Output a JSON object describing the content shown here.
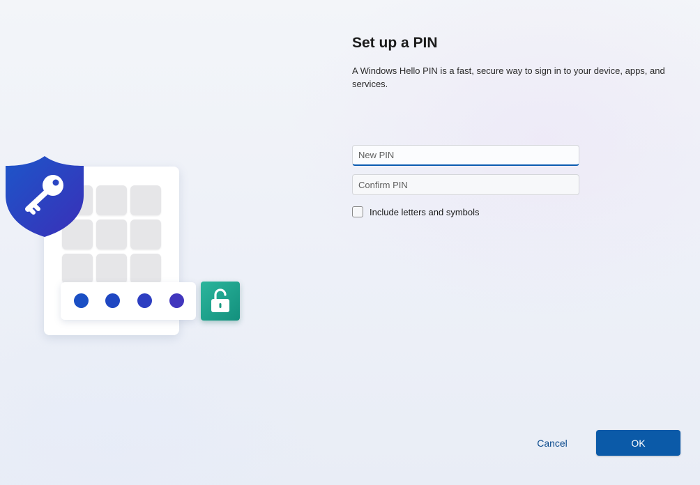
{
  "page": {
    "title": "Set up a PIN",
    "description": "A Windows Hello PIN is a fast, secure way to sign in to your device, apps, and services."
  },
  "form": {
    "new_pin": {
      "placeholder": "New PIN",
      "value": ""
    },
    "confirm_pin": {
      "placeholder": "Confirm PIN",
      "value": ""
    },
    "include_letters": {
      "label": "Include letters and symbols",
      "checked": false
    }
  },
  "buttons": {
    "cancel": "Cancel",
    "ok": "OK"
  },
  "illustration": {
    "icons": [
      "shield-key-icon",
      "keypad",
      "pin-dots",
      "unlocked-padlock-icon"
    ],
    "dot_colors": [
      "#1a4fc4",
      "#1f47c2",
      "#2d3ec1",
      "#4136bd"
    ]
  },
  "colors": {
    "accent": "#0b5aa8",
    "link": "#0a4a8c",
    "lock_tile": "#1ca48c"
  }
}
